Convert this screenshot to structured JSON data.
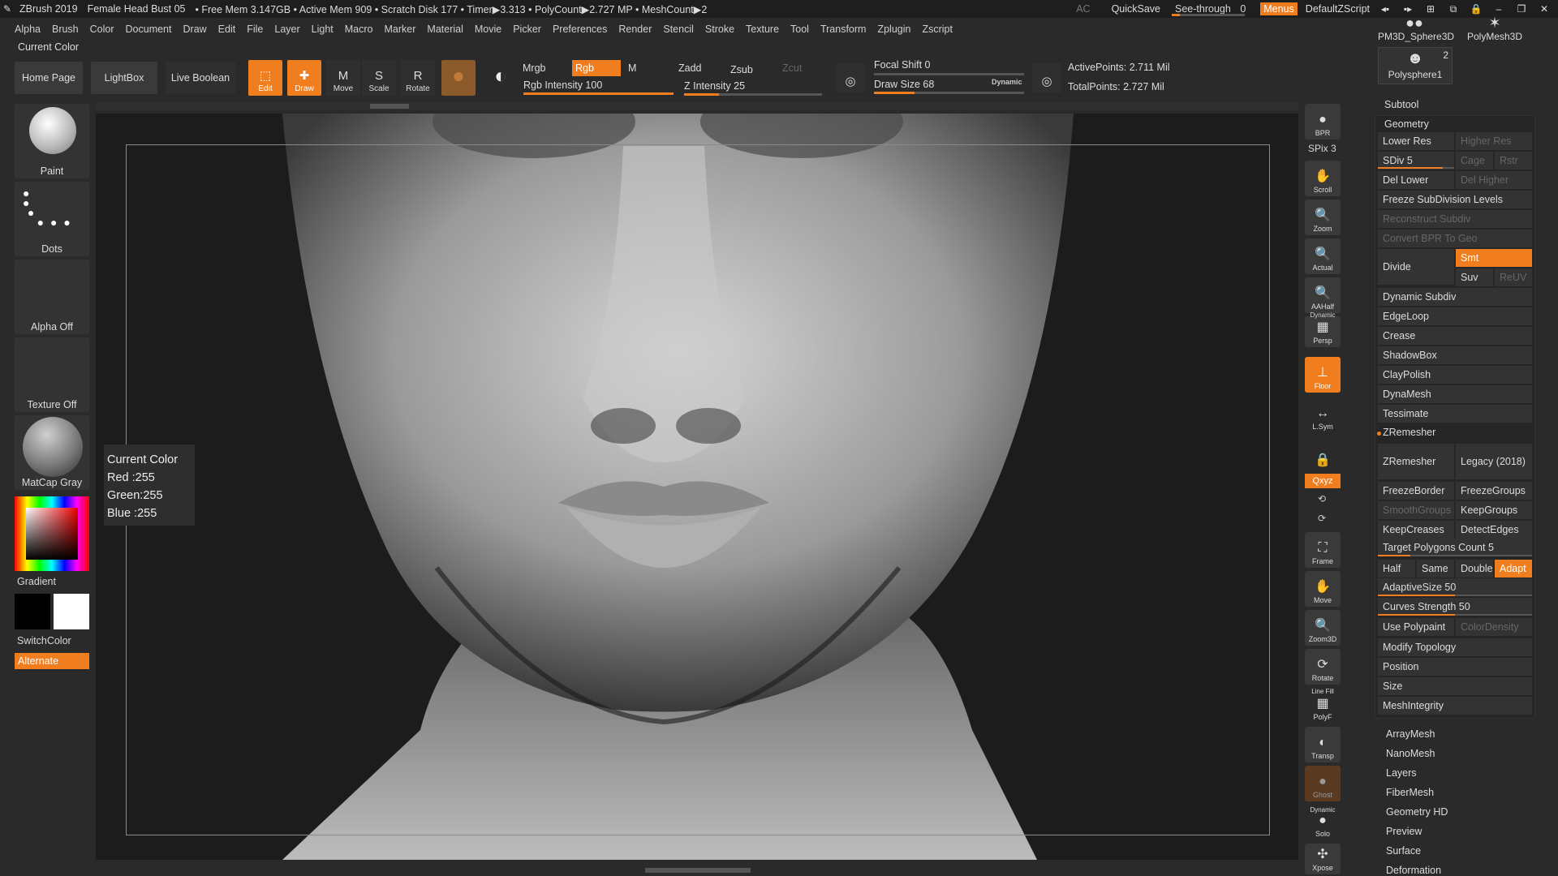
{
  "titlebar": {
    "app": "ZBrush 2019",
    "file": "Female Head Bust 05",
    "status": "• Free Mem 3.147GB • Active Mem 909 • Scratch Disk 177 • Timer▶3.313 • PolyCount▶2.727 MP • MeshCount▶2",
    "ac": "AC",
    "quicksave": "QuickSave",
    "seethrough": "See-through",
    "seethrough_value": "0",
    "seethrough_level": 0,
    "menus": "Menus",
    "script": "DefaultZScript"
  },
  "menubar": [
    "Alpha",
    "Brush",
    "Color",
    "Document",
    "Draw",
    "Edit",
    "File",
    "Layer",
    "Light",
    "Macro",
    "Marker",
    "Material",
    "Movie",
    "Picker",
    "Preferences",
    "Render",
    "Stencil",
    "Stroke",
    "Texture",
    "Tool",
    "Transform",
    "Zplugin",
    "Zscript"
  ],
  "current_color_label": "Current Color",
  "toolbar": {
    "home": "Home Page",
    "lightbox": "LightBox",
    "live_boolean": "Live Boolean",
    "edit": "Edit",
    "draw": "Draw",
    "move": "Move",
    "scale": "Scale",
    "rotate": "Rotate",
    "mrgb": "Mrgb",
    "rgb": "Rgb",
    "m": "M",
    "zadd": "Zadd",
    "zsub": "Zsub",
    "zcut": "Zcut",
    "rgb_intensity": "Rgb Intensity 100",
    "rgb_intensity_value": 100,
    "z_intensity": "Z Intensity 25",
    "z_intensity_value": 25,
    "focal_shift": "Focal Shift 0",
    "draw_size": "Draw Size 68",
    "dynamic": "Dynamic",
    "active_points": "ActivePoints: 2.711 Mil",
    "total_points": "TotalPoints: 2.727 Mil"
  },
  "shelf": {
    "brush": "Paint",
    "stroke": "Dots",
    "alpha": "Alpha Off",
    "texture": "Texture Off",
    "material": "MatCap Gray",
    "gradient": "Gradient",
    "switchcolor": "SwitchColor",
    "alternate": "Alternate"
  },
  "tooltip": {
    "title": "Current Color",
    "red": "Red :255",
    "green": "Green:255",
    "blue": "Blue :255"
  },
  "right_tools": {
    "bpr": "BPR",
    "spix": "SPix 3",
    "scroll": "Scroll",
    "zoom": "Zoom",
    "actual": "Actual",
    "aahalf": "AAHalf",
    "persp": "Persp",
    "dynamic": "Dynamic",
    "floor": "Floor",
    "lsym": "L.Sym",
    "xyz": "Qxyz",
    "frame": "Frame",
    "move": "Move",
    "zoom3d": "Zoom3D",
    "rotate": "Rotate",
    "linefill": "Line Fill",
    "polyf": "PolyF",
    "transp": "Transp",
    "ghost": "Ghost",
    "solo": "Solo",
    "xpose": "Xpose"
  },
  "subtools": {
    "pm3d": "PM3D_Sphere3D",
    "polymesh": "PolyMesh3D",
    "polysphere": "Polysphere1",
    "count": "2"
  },
  "panel": {
    "subtool": "Subtool",
    "geometry": "Geometry",
    "lower_res": "Lower Res",
    "higher_res": "Higher Res",
    "sdiv": "SDiv 5",
    "cage": "Cage",
    "rstr": "Rstr",
    "del_lower": "Del Lower",
    "del_higher": "Del Higher",
    "freeze_subdiv": "Freeze SubDivision Levels",
    "reconstruct": "Reconstruct Subdiv",
    "convert_bpr": "Convert BPR To Geo",
    "divide": "Divide",
    "smt": "Smt",
    "suv": "Suv",
    "reuv": "ReUV",
    "dynamic_subdiv": "Dynamic Subdiv",
    "edgeloop": "EdgeLoop",
    "crease": "Crease",
    "shadowbox": "ShadowBox",
    "claypolish": "ClayPolish",
    "dynamesh": "DynaMesh",
    "tessimate": "Tessimate",
    "zremesher_header": "ZRemesher",
    "zremesher": "ZRemesher",
    "legacy": "Legacy (2018)",
    "freezeborder": "FreezeBorder",
    "freezegroups": "FreezeGroups",
    "smoothgroups": "SmoothGroups",
    "keepgroups": "KeepGroups",
    "keepcreases": "KeepCreases",
    "detectedges": "DetectEdges",
    "target_poly": "Target Polygons Count 5",
    "half": "Half",
    "same": "Same",
    "double": "Double",
    "adapt": "Adapt",
    "adaptive_size": "AdaptiveSize 50",
    "curves_strength": "Curves Strength 50",
    "use_polypaint": "Use Polypaint",
    "color_density": "ColorDensity",
    "modify_topology": "Modify Topology",
    "position": "Position",
    "size": "Size",
    "meshintegrity": "MeshIntegrity",
    "arraymesh": "ArrayMesh",
    "nanomesh": "NanoMesh",
    "layers": "Layers",
    "fibermesh": "FiberMesh",
    "geometry_hd": "Geometry HD",
    "preview": "Preview",
    "surface": "Surface",
    "deformation": "Deformation"
  },
  "colors": {
    "accent": "#f07e1e",
    "background": "#2a2a2a"
  }
}
